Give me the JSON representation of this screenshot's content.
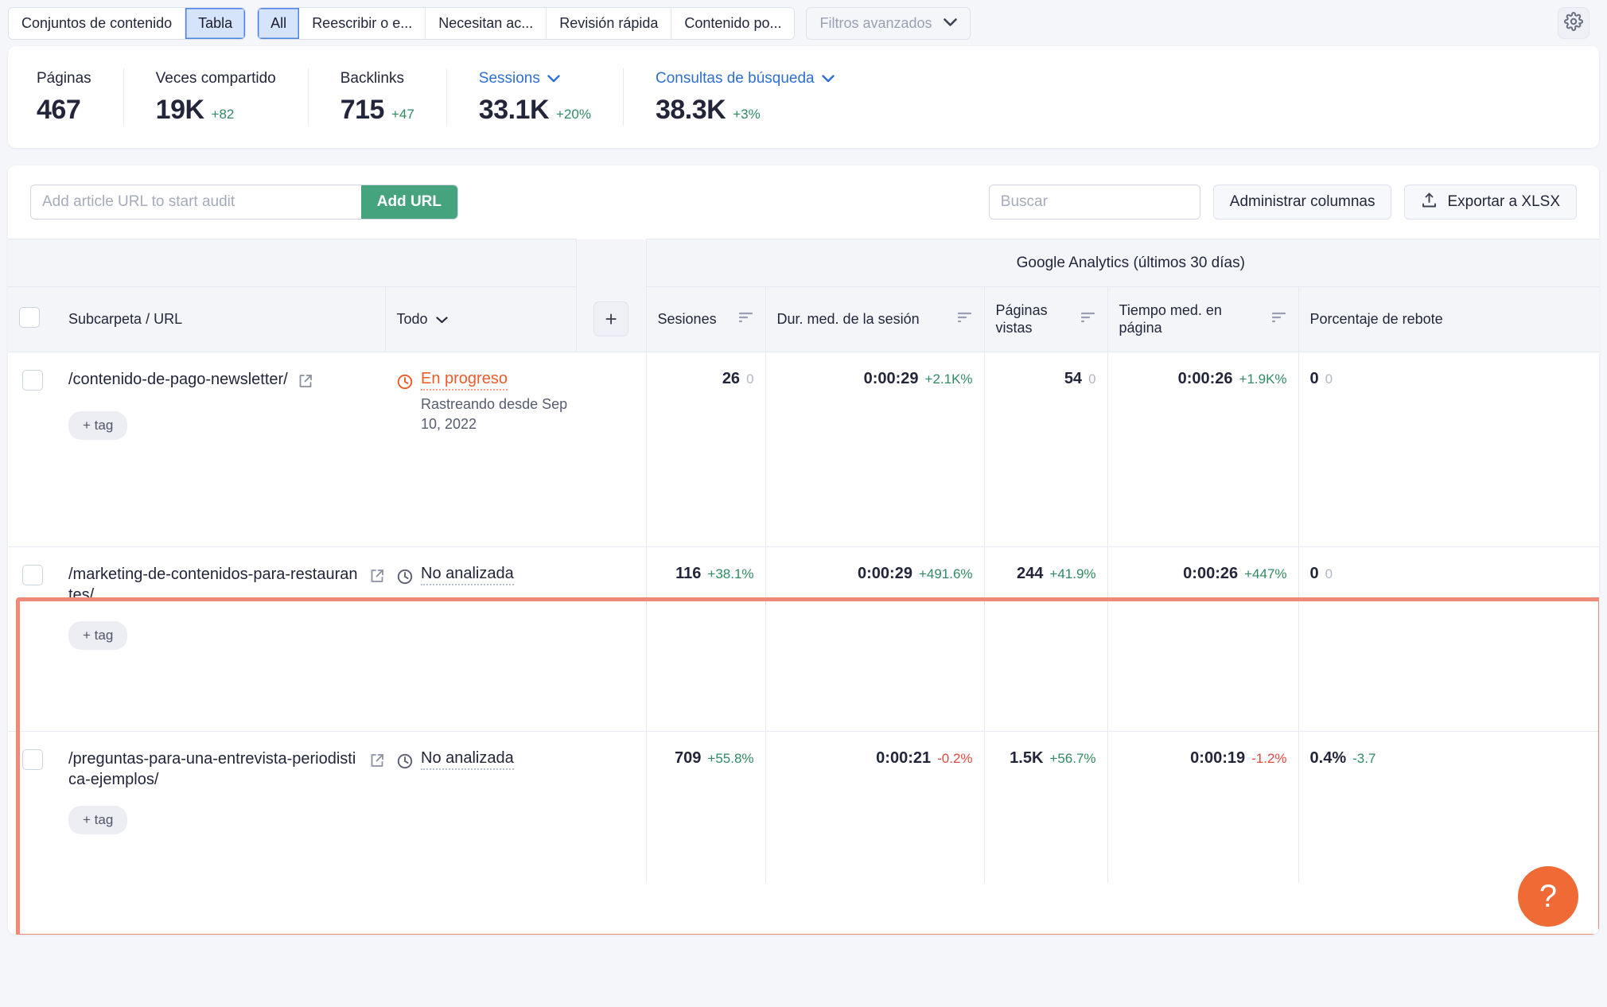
{
  "topbar": {
    "group1": [
      {
        "label": "Conjuntos de contenido",
        "active": false
      },
      {
        "label": "Tabla",
        "active": true
      }
    ],
    "group2": [
      {
        "label": "All",
        "active": true
      },
      {
        "label": "Reescribir o e...",
        "active": false
      },
      {
        "label": "Necesitan ac...",
        "active": false
      },
      {
        "label": "Revisión rápida",
        "active": false
      },
      {
        "label": "Contenido po...",
        "active": false
      }
    ],
    "advanced_filters": "Filtros avanzados",
    "chevron": "⌄",
    "gear_icon": "gear-icon"
  },
  "stats": [
    {
      "label": "Páginas",
      "value": "467",
      "delta": "",
      "link": false
    },
    {
      "label": "Veces compartido",
      "value": "19K",
      "delta": "+82",
      "link": false
    },
    {
      "label": "Backlinks",
      "value": "715",
      "delta": "+47",
      "link": false
    },
    {
      "label": "Sessions",
      "value": "33.1K",
      "delta": "+20%",
      "link": true
    },
    {
      "label": "Consultas de búsqueda",
      "value": "38.3K",
      "delta": "+3%",
      "link": true
    }
  ],
  "toolbar": {
    "url_placeholder": "Add article URL to start audit",
    "url_value": "",
    "add_url_label": "Add URL",
    "search_placeholder": "Buscar",
    "search_value": "",
    "search_icon": "search-icon",
    "manage_columns_label": "Administrar columnas",
    "export_label": "Exportar a XLSX",
    "export_icon": "upload-icon"
  },
  "table": {
    "group_header": "Google Analytics (últimos 30 días)",
    "col_url": "Subcarpeta / URL",
    "col_status": "Todo",
    "col_status_chevron": "⌄",
    "add_column_label": "+",
    "columns": [
      {
        "label": "Sesiones",
        "sortable": true
      },
      {
        "label": "Dur. med. de la sesión",
        "sortable": true
      },
      {
        "label": "Páginas vistas",
        "sortable": true
      },
      {
        "label": "Tiempo med. en página",
        "sortable": true
      },
      {
        "label": "Porcentaje de rebote",
        "sortable": false
      }
    ],
    "tag_label": "+ tag",
    "rows": [
      {
        "url": "/contenido-de-pago-newsletter/",
        "status": "En progreso",
        "status_kind": "progress",
        "status_sub": "Rastreando desde Sep 10, 2022",
        "metrics": [
          {
            "value": "26",
            "delta": "0",
            "dir": "zero"
          },
          {
            "value": "0:00:29",
            "delta": "+2.1K%",
            "dir": "pos"
          },
          {
            "value": "54",
            "delta": "0",
            "dir": "zero"
          },
          {
            "value": "0:00:26",
            "delta": "+1.9K%",
            "dir": "pos"
          },
          {
            "value": "0",
            "delta": "0",
            "dir": "zero"
          }
        ]
      },
      {
        "url": "/marketing-de-contenidos-para-restaurantes/",
        "status": "No analizada",
        "status_kind": "none",
        "status_sub": "",
        "metrics": [
          {
            "value": "116",
            "delta": "+38.1%",
            "dir": "pos"
          },
          {
            "value": "0:00:29",
            "delta": "+491.6%",
            "dir": "pos"
          },
          {
            "value": "244",
            "delta": "+41.9%",
            "dir": "pos"
          },
          {
            "value": "0:00:26",
            "delta": "+447%",
            "dir": "pos"
          },
          {
            "value": "0",
            "delta": "0",
            "dir": "zero"
          }
        ]
      },
      {
        "url": "/preguntas-para-una-entrevista-periodistica-ejemplos/",
        "status": "No analizada",
        "status_kind": "none",
        "status_sub": "",
        "metrics": [
          {
            "value": "709",
            "delta": "+55.8%",
            "dir": "pos"
          },
          {
            "value": "0:00:21",
            "delta": "-0.2%",
            "dir": "neg"
          },
          {
            "value": "1.5K",
            "delta": "+56.7%",
            "dir": "pos"
          },
          {
            "value": "0:00:19",
            "delta": "-1.2%",
            "dir": "neg"
          },
          {
            "value": "0.4%",
            "delta": "-3.7",
            "dir": "pos"
          }
        ]
      }
    ]
  },
  "help": {
    "label": "?",
    "icon": "question-mark-icon"
  },
  "colors": {
    "accent_blue": "#2f6fd0",
    "green": "#45a37d",
    "delta_positive": "#2f8a62",
    "delta_negative": "#e04a3f",
    "status_progress": "#f05a28",
    "selection_border": "#f08a78",
    "help_fab": "#f06a36"
  }
}
